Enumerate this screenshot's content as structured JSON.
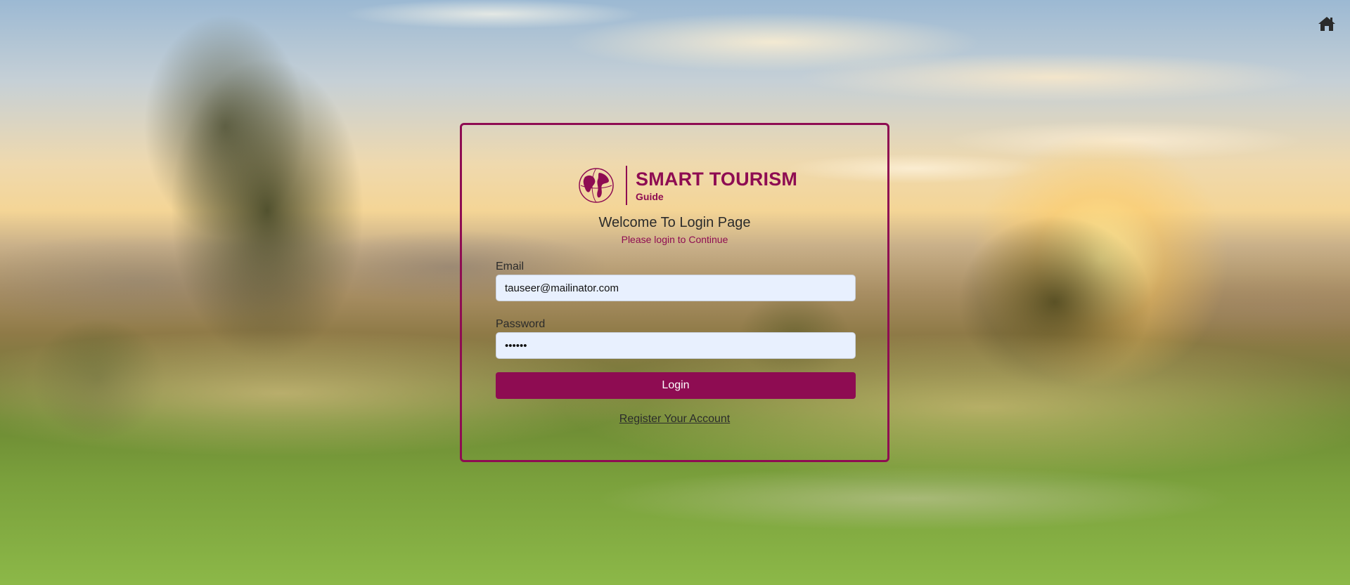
{
  "header": {
    "home_icon": "home-icon"
  },
  "brand": {
    "title": "SMART TOURISM",
    "subtitle": "Guide",
    "logo_icon": "globe-icon",
    "color": "#8e0c52"
  },
  "login": {
    "heading": "Welcome To Login Page",
    "subheading": "Please login to Continue",
    "email": {
      "label": "Email",
      "value": "tauseer@mailinator.com"
    },
    "password": {
      "label": "Password",
      "value": "••••••"
    },
    "submit_label": "Login",
    "register_link": "Register Your Account"
  },
  "colors": {
    "accent": "#8e0c52",
    "input_background": "#e8f0fe",
    "button_text": "#ffffff"
  }
}
